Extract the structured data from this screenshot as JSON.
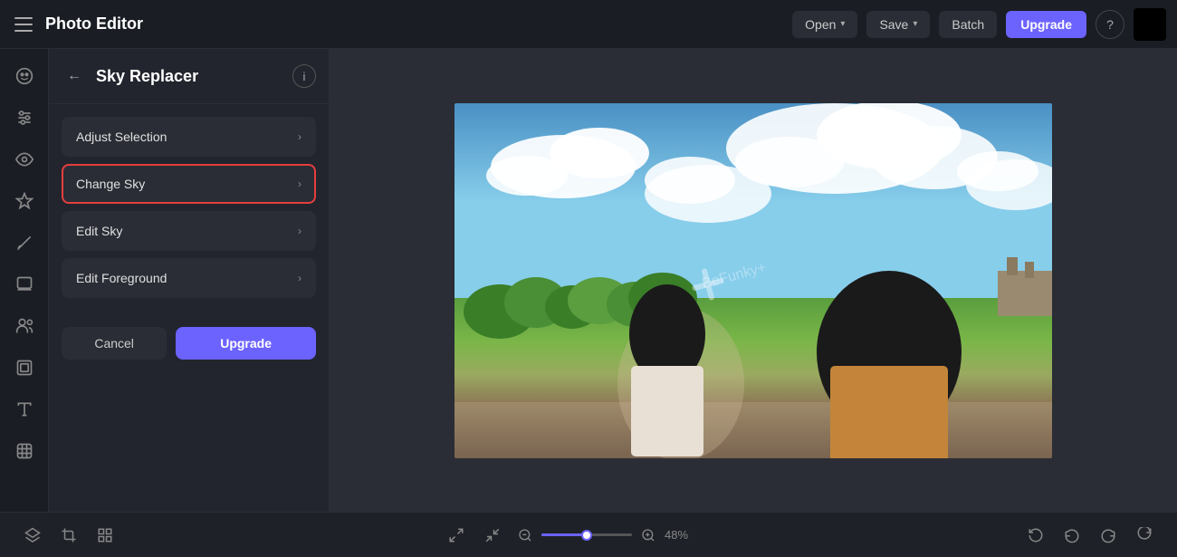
{
  "app": {
    "title": "Photo Editor",
    "menu_icon": "menu-icon"
  },
  "header": {
    "open_label": "Open",
    "save_label": "Save",
    "batch_label": "Batch",
    "upgrade_label": "Upgrade",
    "help_label": "?"
  },
  "sidebar": {
    "icons": [
      {
        "name": "face-icon",
        "symbol": "☺"
      },
      {
        "name": "adjust-icon",
        "symbol": "⚙"
      },
      {
        "name": "eye-icon",
        "symbol": "◉"
      },
      {
        "name": "magic-icon",
        "symbol": "✦"
      },
      {
        "name": "brush-icon",
        "symbol": "✏"
      },
      {
        "name": "layers-icon",
        "symbol": "⊞"
      },
      {
        "name": "people-icon",
        "symbol": "⊙"
      },
      {
        "name": "frame-icon",
        "symbol": "▦"
      },
      {
        "name": "text-icon",
        "symbol": "T"
      },
      {
        "name": "sticker-icon",
        "symbol": "◈"
      }
    ]
  },
  "panel": {
    "title": "Sky Replacer",
    "back_label": "←",
    "info_label": "i",
    "menu_items": [
      {
        "id": "adjust-selection",
        "label": "Adjust Selection",
        "active": false
      },
      {
        "id": "change-sky",
        "label": "Change Sky",
        "active": true
      },
      {
        "id": "edit-sky",
        "label": "Edit Sky",
        "active": false
      },
      {
        "id": "edit-foreground",
        "label": "Edit Foreground",
        "active": false
      }
    ],
    "cancel_label": "Cancel",
    "upgrade_label": "Upgrade"
  },
  "bottom_toolbar": {
    "left_icons": [
      {
        "name": "layers-bottom-icon",
        "symbol": "⊟"
      },
      {
        "name": "crop-icon",
        "symbol": "⊞"
      },
      {
        "name": "grid-icon",
        "symbol": "⊠"
      }
    ],
    "center_icons": [
      {
        "name": "fit-screen-icon",
        "symbol": "⛶"
      },
      {
        "name": "actual-size-icon",
        "symbol": "⊡"
      }
    ],
    "zoom": {
      "minus_label": "−",
      "plus_label": "+",
      "value": "48%"
    },
    "right_icons": [
      {
        "name": "rotate-left-icon",
        "symbol": "↺"
      },
      {
        "name": "undo-icon",
        "symbol": "↩"
      },
      {
        "name": "redo-icon",
        "symbol": "↪"
      },
      {
        "name": "rotate-right-icon",
        "symbol": "↻"
      }
    ]
  }
}
